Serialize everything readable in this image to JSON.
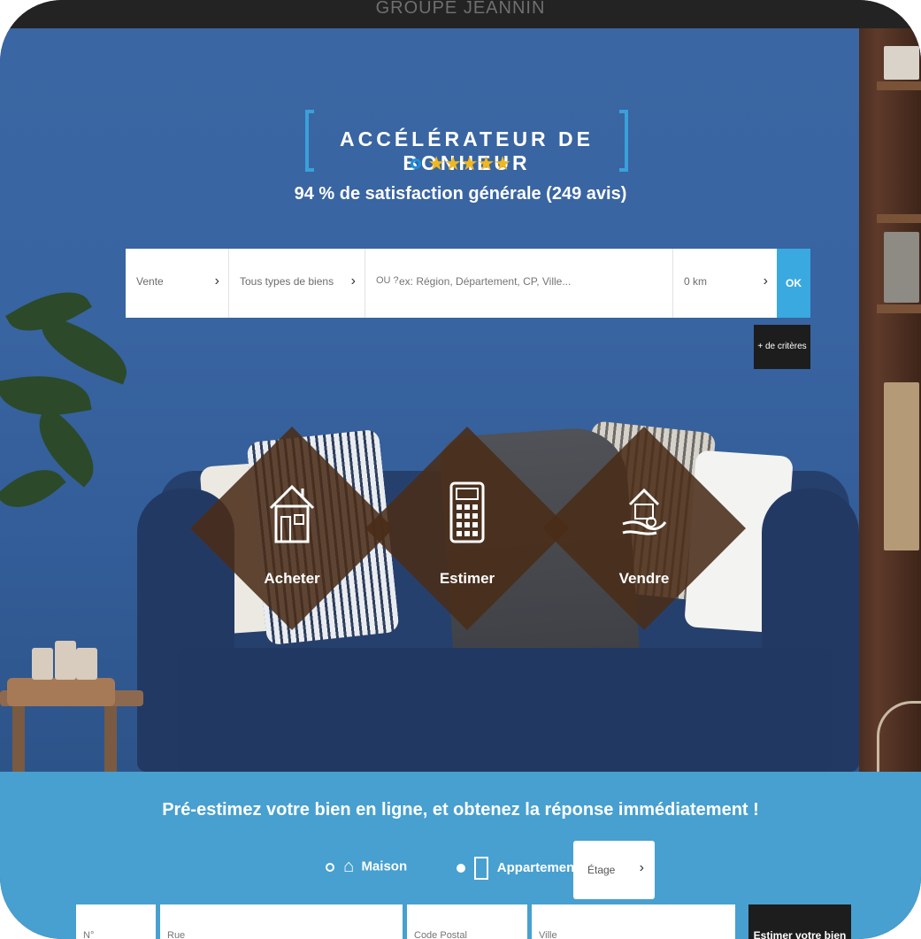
{
  "topbar": {
    "brand": "GROUPE JEANNIN"
  },
  "hero": {
    "tagline": "ACCÉLÉRATEUR DE BONHEUR",
    "rating": {
      "stars": "★★★★★",
      "icon": "google-icon"
    },
    "satisfaction": "94 % de satisfaction générale (249 avis)"
  },
  "search": {
    "transaction": "Vente",
    "property_type": "Tous types de biens",
    "location_icon": "pin-icon",
    "location_prefix": "OU ?",
    "location_placeholder": "ex: Région, Département, CP, Ville...",
    "radius": "0 km",
    "submit": "OK",
    "more_criteria": "+ de critères"
  },
  "actions": [
    {
      "label": "Acheter",
      "icon": "house-icon"
    },
    {
      "label": "Estimer",
      "icon": "calculator-icon"
    },
    {
      "label": "Vendre",
      "icon": "hand-house-icon"
    }
  ],
  "estimation": {
    "title": "Pré-estimez votre bien en ligne, et obtenez la réponse immédiatement !",
    "option_house": "Maison",
    "option_apartment": "Appartement",
    "floor": "Étage",
    "number_placeholder": "N°",
    "street_placeholder": "Rue",
    "postal_placeholder": "Code Postal",
    "city_placeholder": "Ville",
    "submit": "Estimer votre bien"
  },
  "colors": {
    "accent": "#3aa9e0",
    "wall": "#3a66a3",
    "diamond": "#4a2c18",
    "star": "#f0b81e",
    "dark_button": "#1d1d1d"
  }
}
